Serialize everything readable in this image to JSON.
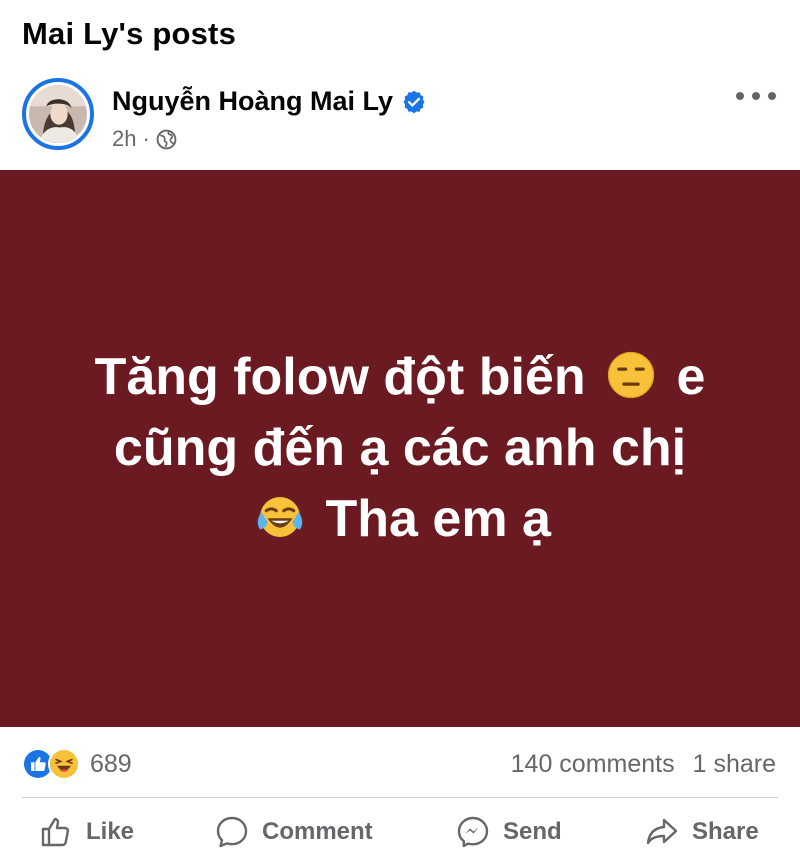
{
  "page": {
    "title": "Mai Ly's posts"
  },
  "post": {
    "author": "Nguyễn Hoàng Mai Ly",
    "time": "2h",
    "separator": "·",
    "visibility_icon": "globe-icon",
    "verified_icon": "verified-badge-icon",
    "more_icon": "more-horizontal-icon",
    "background_color": "#6b1a22",
    "text_color": "#ffffff",
    "text_part1": "Tăng folow đột biến",
    "emoji1": "expressionless-face-emoji",
    "text_part2": "e cũng đến ạ các anh chị",
    "emoji2": "tears-of-joy-emoji",
    "text_part3": "Tha em ạ"
  },
  "stats": {
    "reactions": [
      "like-reaction-icon",
      "haha-reaction-icon"
    ],
    "reaction_count": "689",
    "comments": "140 comments",
    "shares": "1 share"
  },
  "actions": {
    "like": "Like",
    "comment": "Comment",
    "send": "Send",
    "share": "Share"
  },
  "colors": {
    "accent": "#1b74e4",
    "secondary_text": "#65676b"
  }
}
